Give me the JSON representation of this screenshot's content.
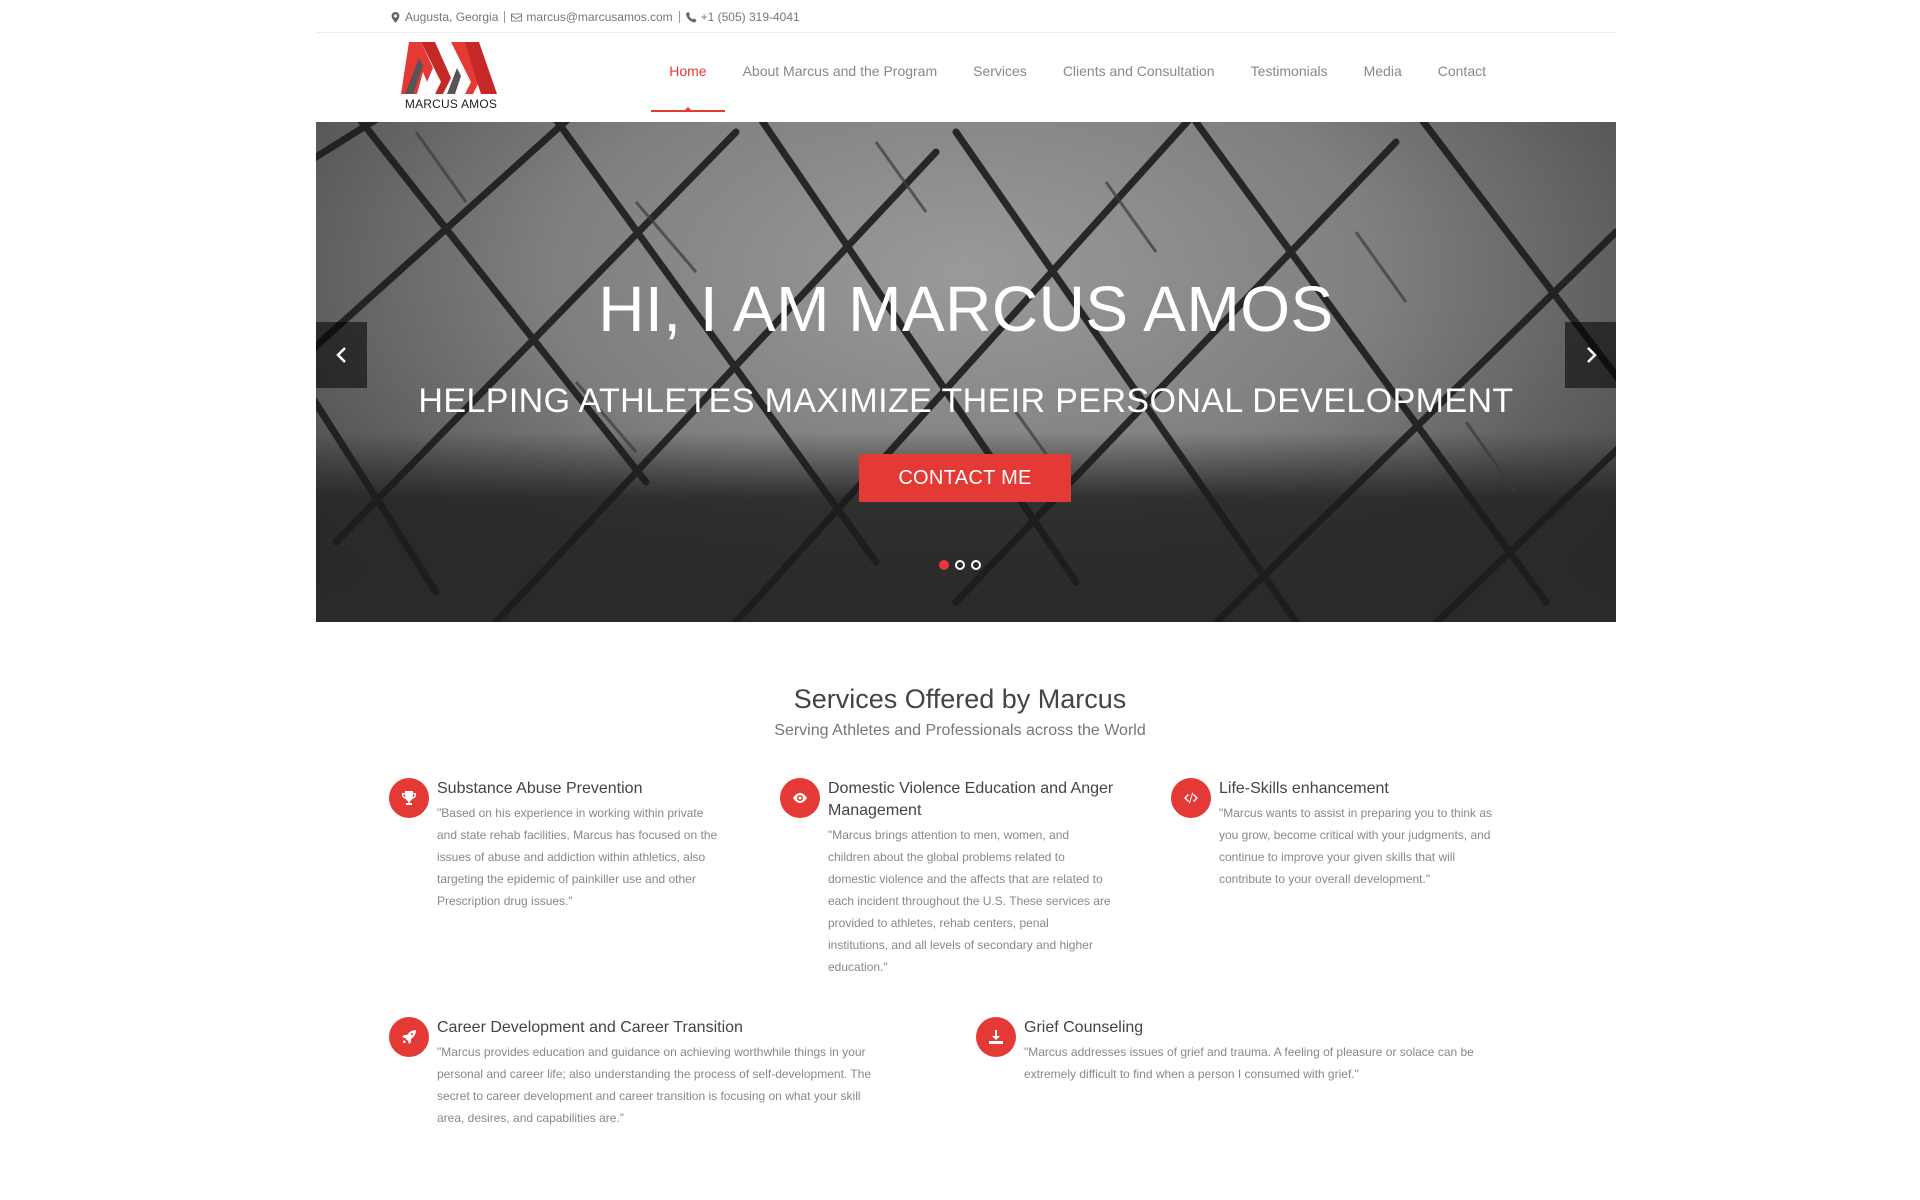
{
  "topbar": {
    "location": "Augusta, Georgia",
    "email": "marcus@marcusamos.com",
    "phone": "+1 (505) 319-4041"
  },
  "logo": {
    "text": "MARCUS AMOS"
  },
  "nav": [
    "Home",
    "About Marcus and the Program",
    "Services",
    "Clients and Consultation",
    "Testimonials",
    "Media",
    "Contact"
  ],
  "hero": {
    "title": "HI, I AM MARCUS AMOS",
    "subtitle": "HELPING ATHLETES MAXIMIZE THEIR PERSONAL DEVELOPMENT",
    "cta": "CONTACT ME",
    "active_slide": 1,
    "slide_count": 3
  },
  "services": {
    "title": "Services Offered by Marcus",
    "subtitle": "Serving Athletes and Professionals across the World",
    "items": [
      {
        "icon": "trophy-icon",
        "title": "Substance Abuse Prevention",
        "lines": [
          "\"Based on his experience in working within private",
          "and state rehab facilities, Marcus has focused on the",
          "issues of abuse and addiction within athletics, also",
          "targeting the epidemic of painkiller use and other",
          "Prescription drug issues.\""
        ]
      },
      {
        "icon": "eye-icon",
        "title_lines": [
          "Domestic Violence Education and Anger",
          "Management"
        ],
        "lines": [
          "\"Marcus brings attention to men, women, and",
          "children about the global problems related to",
          "domestic violence and the affects that are related to",
          "each incident throughout the U.S. These services are",
          "provided to athletes, rehab centers, penal",
          "institutions, and all levels of secondary and higher",
          "education.\""
        ]
      },
      {
        "icon": "code-icon",
        "title": "Life-Skills enhancement",
        "lines": [
          "\"Marcus wants to assist in preparing you to think as",
          "you grow, become critical with your judgments, and",
          "continue to improve your given skills that will",
          "contribute to your overall development.\""
        ]
      },
      {
        "icon": "rocket-icon",
        "title": "Career Development and Career Transition",
        "lines": [
          "\"Marcus provides education and guidance on achieving worthwhile things in your",
          "personal and career life; also understanding the process of self-development. The",
          "secret to career development and career transition is focusing on what your skill",
          "area, desires, and capabilities are.\""
        ]
      },
      {
        "icon": "download-icon",
        "title": "Grief Counseling",
        "lines": [
          "\"Marcus addresses issues of grief and trauma. A feeling of pleasure or solace can be",
          "extremely difficult to find when a person I consumed with grief.\""
        ]
      }
    ]
  },
  "colors": {
    "accent": "#e53935"
  }
}
